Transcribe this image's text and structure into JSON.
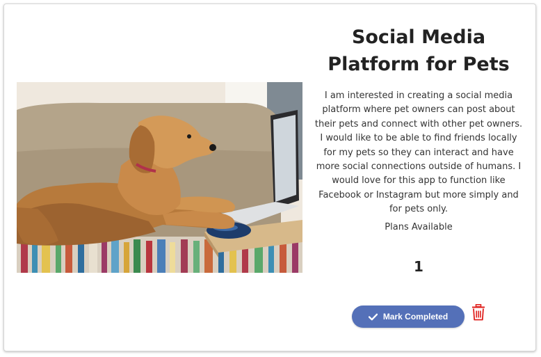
{
  "card": {
    "title": "Social Media Platform for Pets",
    "description": "I am interested in creating a social media platform where pet owners can post about their pets and connect with other pet owners. I would like to be able to find friends locally for my pets so they can interact and have more social connections outside of humans. I would love for this app to function like Facebook or Instagram but more simply and for pets only.",
    "plans_label": "Plans Available",
    "plans_count": "1",
    "mark_completed_label": "Mark Completed",
    "icons": {
      "button_icon": "check-icon",
      "delete_icon": "trash-icon"
    }
  },
  "colors": {
    "button": "#5470b8",
    "delete": "#e0201d"
  }
}
